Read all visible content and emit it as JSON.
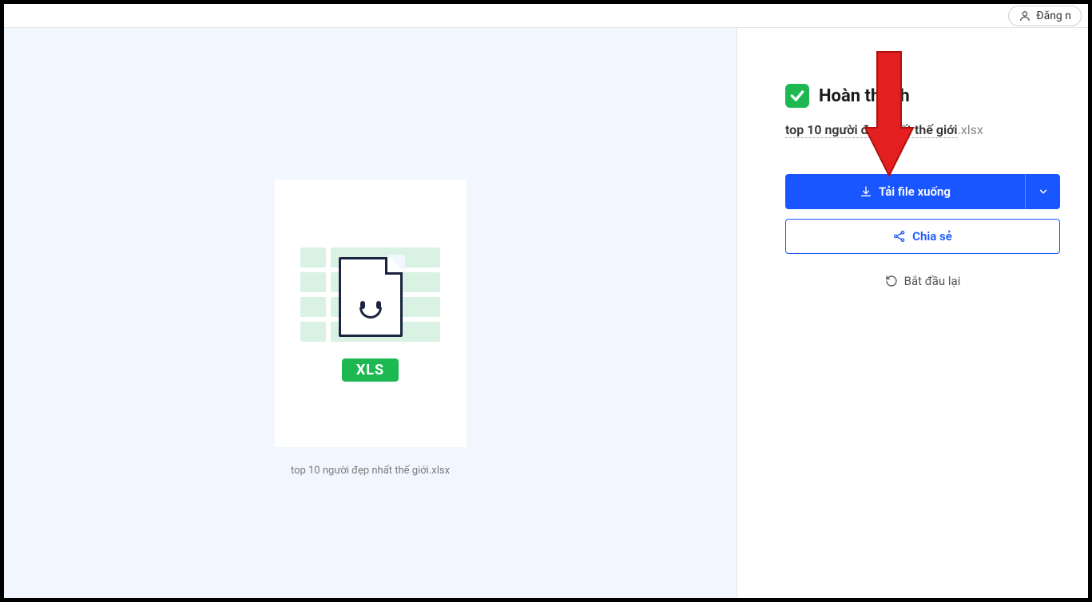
{
  "header": {
    "login_label": "Đăng n"
  },
  "preview": {
    "badge": "XLS",
    "filename": "top 10 người đẹp nhất thế giới.xlsx"
  },
  "status": {
    "label": "Hoàn thành",
    "file_base": "top 10 người đẹp nhất thế giới",
    "file_ext": ".xlsx"
  },
  "buttons": {
    "download": "Tải file xuống",
    "share": "Chia sẻ",
    "restart": "Bắt đầu lại"
  },
  "colors": {
    "primary": "#1a56ff",
    "success": "#1eb853",
    "annotation": "#e3201f"
  }
}
